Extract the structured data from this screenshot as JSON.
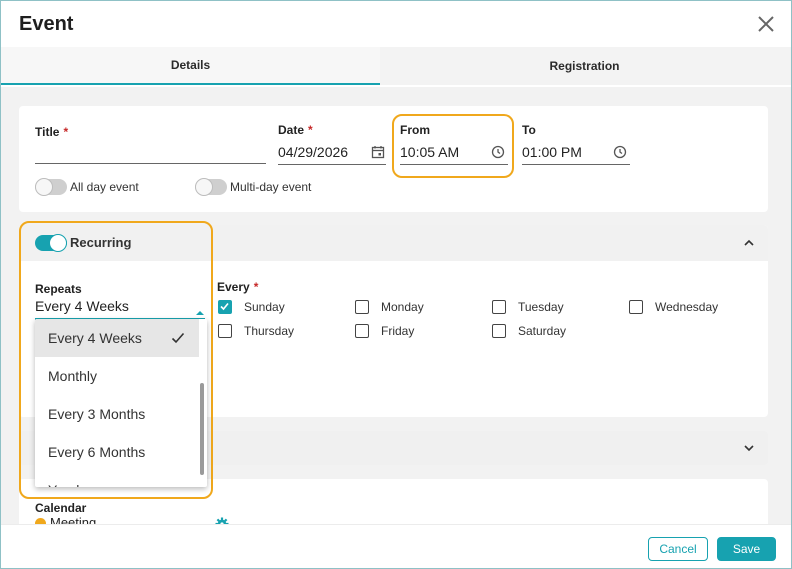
{
  "dialog": {
    "title": "Event"
  },
  "tabs": [
    {
      "label": "Details"
    },
    {
      "label": "Registration"
    }
  ],
  "fields": {
    "title": {
      "label": "Title",
      "value": ""
    },
    "date": {
      "label": "Date",
      "value": "04/29/2026"
    },
    "from": {
      "label": "From",
      "value": "10:05 AM"
    },
    "to": {
      "label": "To",
      "value": "01:00 PM"
    },
    "required_marker": "*"
  },
  "toggles": {
    "all_day": {
      "label": "All day event",
      "on": false
    },
    "multi_day": {
      "label": "Multi-day event",
      "on": false
    },
    "recurring": {
      "label": "Recurring",
      "on": true
    }
  },
  "recurrence": {
    "repeats_label": "Repeats",
    "repeats_value": "Every 4 Weeks",
    "every_label": "Every",
    "days": [
      {
        "label": "Sunday",
        "checked": true
      },
      {
        "label": "Monday",
        "checked": false
      },
      {
        "label": "Tuesday",
        "checked": false
      },
      {
        "label": "Wednesday",
        "checked": false
      },
      {
        "label": "Thursday",
        "checked": false
      },
      {
        "label": "Friday",
        "checked": false
      },
      {
        "label": "Saturday",
        "checked": false
      }
    ],
    "options": [
      "Every 4 Weeks",
      "Monthly",
      "Every 3 Months",
      "Every 6 Months",
      "Yearly"
    ],
    "selected_option": "Every 4 Weeks"
  },
  "calendar": {
    "label": "Calendar",
    "value": "Meeting",
    "dot_color": "#f0a81c"
  },
  "footer": {
    "cancel_label": "Cancel",
    "save_label": "Save"
  },
  "colors": {
    "accent": "#17a2b0",
    "highlight": "#f0a81c",
    "required": "#c62828"
  }
}
